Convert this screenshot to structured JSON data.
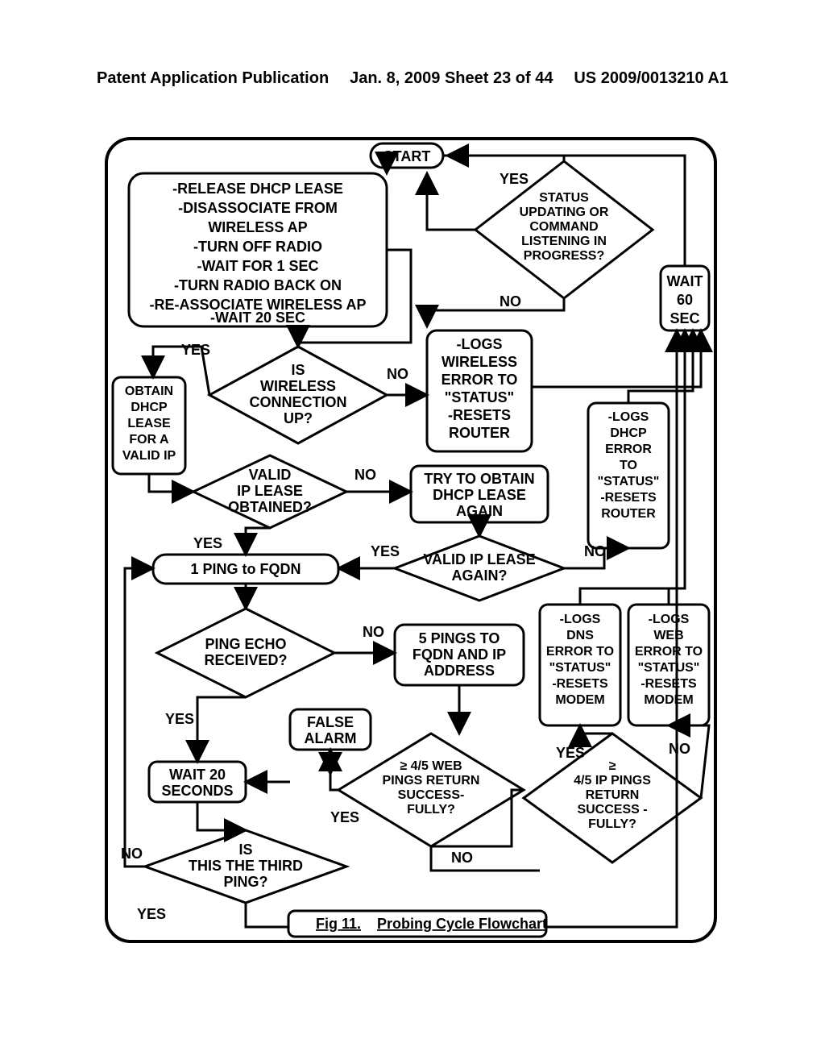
{
  "header": {
    "left": "Patent Application Publication",
    "center": "Jan. 8, 2009  Sheet 23 of 44",
    "right": "US 2009/0013210 A1"
  },
  "nodes": {
    "start": "START",
    "reset": "-RELEASE DHCP LEASE\n-DISASSOCIATE FROM\nWIRELESS AP\n-TURN OFF RADIO\n-WAIT FOR 1 SEC\n-TURN RADIO BACK ON\n-RE-ASSOCIATE WIRELESS AP\n-WAIT 20 SEC",
    "statusQ": "STATUS\nUPDATING OR\nCOMMAND\nLISTENING IN\nPROGRESS?",
    "wait60": "WAIT\n60\nSEC",
    "wirelessQ": "IS\nWIRELESS\nCONNECTION\nUP?",
    "logWireless": "-LOGS\nWIRELESS\nERROR TO\n\"STATUS\"\n-RESETS\nROUTER",
    "obtainDhcp": "OBTAIN\nDHCP\nLEASE\nFOR A\nVALID IP",
    "validIpQ": "VALID\nIP LEASE\nOBTAINED?",
    "tryDhcp": "TRY TO OBTAIN\nDHCP LEASE\nAGAIN",
    "validIp2Q": "VALID IP LEASE\nAGAIN?",
    "logDhcp": "-LOGS\nDHCP\nERROR\nTO\n\"STATUS\"\n-RESETS\nROUTER",
    "ping1": "1 PING to FQDN",
    "pingEchoQ": "PING ECHO\nRECEIVED?",
    "ping5": "5 PINGS TO\nFQDN AND IP\nADDRESS",
    "logDns": "-LOGS\nDNS\nERROR TO\n\"STATUS\"\n-RESETS\nMODEM",
    "logWeb": "-LOGS\nWEB\nERROR TO\n\"STATUS\"\n-RESETS\nMODEM",
    "falseAlarm": "FALSE\nALARM",
    "wait20": "WAIT 20\nSECONDS",
    "webPingsQ": "≥ 4/5 WEB\nPINGS RETURN\nSUCCESS-\nFULLY?",
    "ipPingsQ": "≥\n4/5 IP PINGS\nRETURN\nSUCCESS -\nFULLY?",
    "thirdPingQ": "IS\nTHIS THE THIRD\nPING?",
    "caption": "Fig 11.  Probing Cycle Flowchart"
  },
  "labels": {
    "yes": "YES",
    "no": "NO"
  }
}
